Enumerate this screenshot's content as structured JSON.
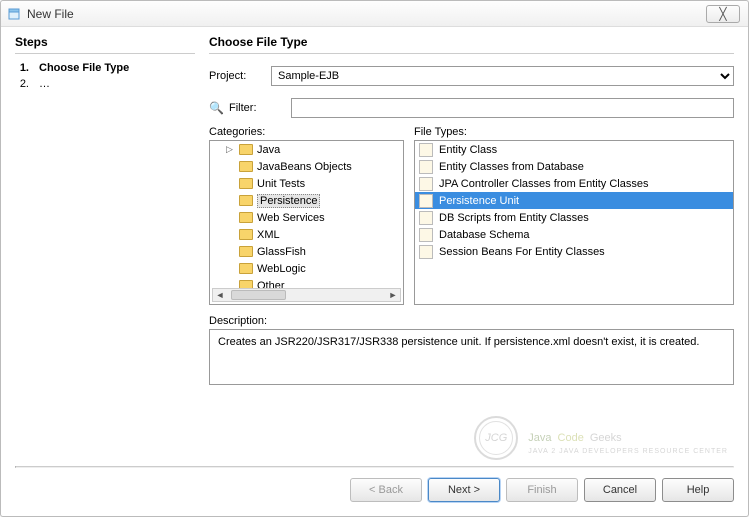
{
  "window": {
    "title": "New File"
  },
  "steps": {
    "heading": "Steps",
    "items": [
      {
        "num": "1.",
        "label": "Choose File Type",
        "current": true
      },
      {
        "num": "2.",
        "label": "…",
        "current": false
      }
    ]
  },
  "main": {
    "heading": "Choose File Type",
    "project_label": "Project:",
    "project_value": "Sample-EJB",
    "filter_label": "Filter:",
    "filter_value": "",
    "categories_label": "Categories:",
    "filetypes_label": "File Types:",
    "categories": [
      {
        "label": "Java",
        "selected": false,
        "expandable": true
      },
      {
        "label": "JavaBeans Objects",
        "selected": false,
        "expandable": false
      },
      {
        "label": "Unit Tests",
        "selected": false,
        "expandable": false
      },
      {
        "label": "Persistence",
        "selected": true,
        "expandable": false
      },
      {
        "label": "Web Services",
        "selected": false,
        "expandable": false
      },
      {
        "label": "XML",
        "selected": false,
        "expandable": false
      },
      {
        "label": "GlassFish",
        "selected": false,
        "expandable": false
      },
      {
        "label": "WebLogic",
        "selected": false,
        "expandable": false
      },
      {
        "label": "Other",
        "selected": false,
        "expandable": false
      }
    ],
    "filetypes": [
      {
        "label": "Entity Class",
        "selected": false
      },
      {
        "label": "Entity Classes from Database",
        "selected": false
      },
      {
        "label": "JPA Controller Classes from Entity Classes",
        "selected": false
      },
      {
        "label": "Persistence Unit",
        "selected": true
      },
      {
        "label": "DB Scripts from Entity Classes",
        "selected": false
      },
      {
        "label": "Database Schema",
        "selected": false
      },
      {
        "label": "Session Beans For Entity Classes",
        "selected": false
      }
    ],
    "description_label": "Description:",
    "description_text": "Creates an JSR220/JSR317/JSR338 persistence unit. If persistence.xml doesn't exist, it is created."
  },
  "buttons": {
    "back": "< Back",
    "next": "Next >",
    "finish": "Finish",
    "cancel": "Cancel",
    "help": "Help"
  },
  "watermark": {
    "badge": "JCG",
    "main_1": "Java",
    "main_2": "Code",
    "main_3": "Geeks",
    "sub": "JAVA 2 JAVA DEVELOPERS RESOURCE CENTER"
  }
}
